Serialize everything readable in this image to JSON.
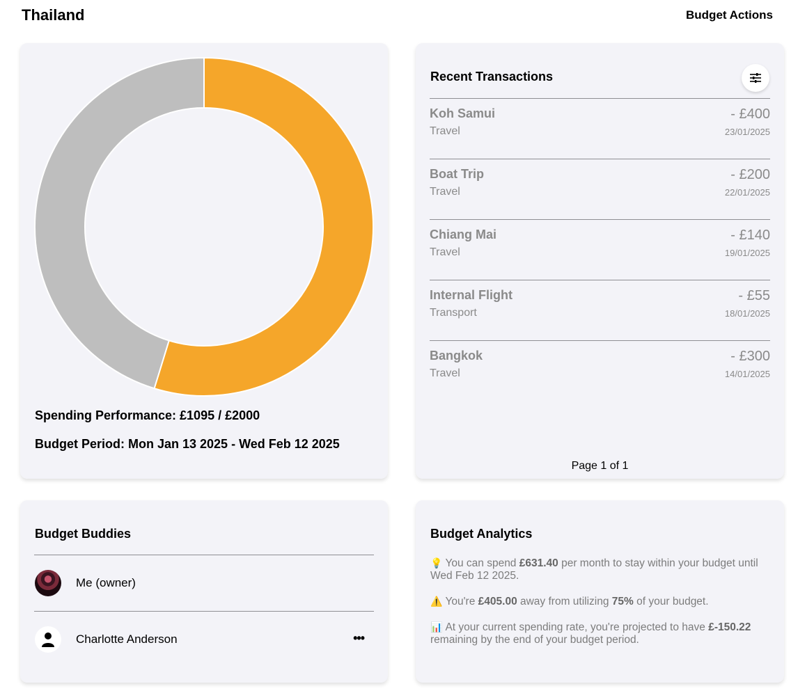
{
  "header": {
    "title": "Thailand",
    "actions_label": "Budget Actions"
  },
  "spending": {
    "spent": 1095,
    "total": 2000,
    "spent_color": "#f5a62a",
    "remaining_color": "#bebebe",
    "performance_text": "Spending Performance: £1095 / £2000",
    "period_text": "Budget Period: Mon Jan 13 2025 - Wed Feb 12 2025"
  },
  "transactions": {
    "title": "Recent Transactions",
    "filter_icon": "sliders-icon",
    "items": [
      {
        "name": "Koh Samui",
        "category": "Travel",
        "amount": "- £400",
        "date": "23/01/2025"
      },
      {
        "name": "Boat Trip",
        "category": "Travel",
        "amount": "- £200",
        "date": "22/01/2025"
      },
      {
        "name": "Chiang Mai",
        "category": "Travel",
        "amount": "- £140",
        "date": "19/01/2025"
      },
      {
        "name": "Internal Flight",
        "category": "Transport",
        "amount": "- £55",
        "date": "18/01/2025"
      },
      {
        "name": "Bangkok",
        "category": "Travel",
        "amount": "- £300",
        "date": "14/01/2025"
      }
    ],
    "pagination": "Page 1 of 1"
  },
  "buddies": {
    "title": "Budget Buddies",
    "items": [
      {
        "name": "Me (owner)",
        "avatar": "photo"
      },
      {
        "name": "Charlotte Anderson",
        "avatar": "person-icon",
        "menu": "•••"
      }
    ]
  },
  "analytics": {
    "title": "Budget Analytics",
    "items": [
      {
        "icon": "lightbulb-icon",
        "emoji": "💡",
        "pre": "You can spend ",
        "b1": "£631.40",
        "mid": " per month to stay within your budget until Wed Feb 12 2025.",
        "b2": "",
        "post": ""
      },
      {
        "icon": "warning-icon",
        "emoji": "⚠️",
        "pre": "You're ",
        "b1": "£405.00",
        "mid": " away from utilizing ",
        "b2": "75%",
        "post": " of your budget."
      },
      {
        "icon": "bar-chart-icon",
        "emoji": "📊",
        "pre": "At your current spending rate, you're projected to have ",
        "b1": "£-150.22",
        "mid": " remaining by the end of your budget period.",
        "b2": "",
        "post": ""
      }
    ]
  }
}
